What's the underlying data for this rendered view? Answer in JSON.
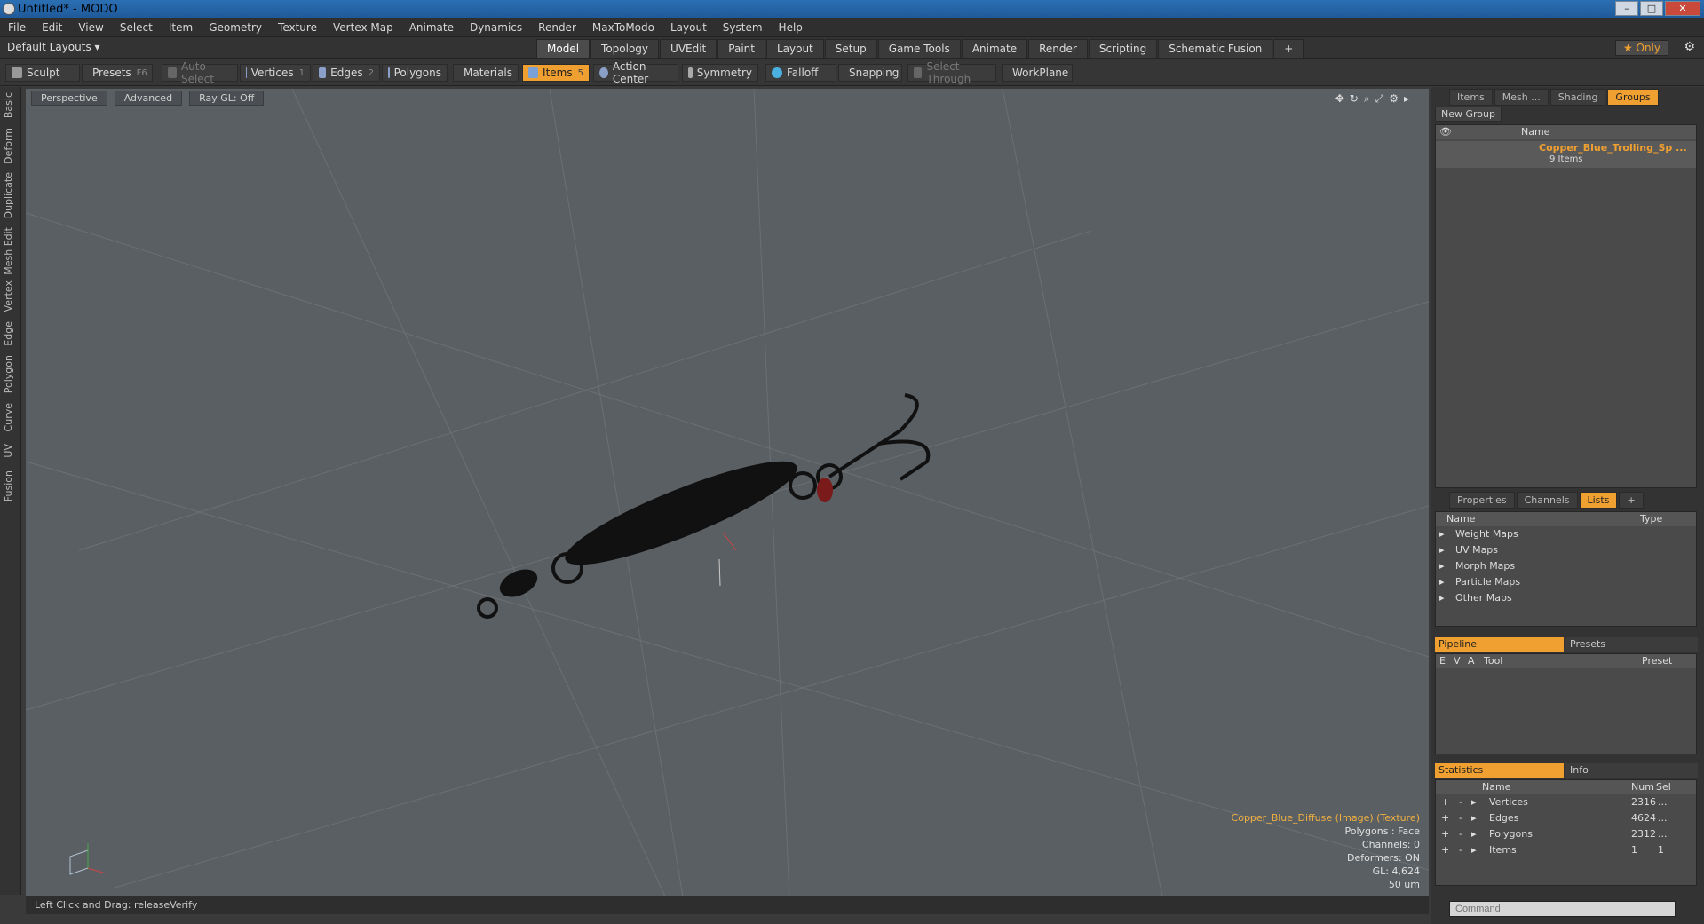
{
  "app": {
    "title": "Untitled* - MODO"
  },
  "menu": [
    "File",
    "Edit",
    "View",
    "Select",
    "Item",
    "Geometry",
    "Texture",
    "Vertex Map",
    "Animate",
    "Dynamics",
    "Render",
    "MaxToModo",
    "Layout",
    "System",
    "Help"
  ],
  "layout": {
    "selector": "Default Layouts ▾",
    "tabs": [
      "Model",
      "Topology",
      "UVEdit",
      "Paint",
      "Layout",
      "Setup",
      "Game Tools",
      "Animate",
      "Render",
      "Scripting",
      "Schematic Fusion",
      "+"
    ],
    "only_label": "★ Only"
  },
  "toolbar": {
    "sculpt": "Sculpt",
    "presets": "Presets",
    "presets_key": "F6",
    "auto_select": "Auto Select",
    "vertices": "Vertices",
    "vertices_key": "1",
    "edges": "Edges",
    "edges_key": "2",
    "polygons": "Polygons",
    "materials": "Materials",
    "items": "Items",
    "items_key": "5",
    "action_center": "Action Center",
    "symmetry": "Symmetry",
    "falloff": "Falloff",
    "snapping": "Snapping",
    "select_through": "Select Through",
    "workplane": "WorkPlane"
  },
  "left_tabs": [
    "Basic",
    "Deform",
    "Duplicate",
    "Mesh Edit",
    "Vertex",
    "Edge",
    "Polygon",
    "Curve",
    "UV",
    "Fusion"
  ],
  "viewport": {
    "perspective": "Perspective",
    "advanced": "Advanced",
    "raygl": "Ray GL: Off",
    "hud": {
      "texture": "Copper_Blue_Diffuse (Image) (Texture)",
      "polygons": "Polygons : Face",
      "channels": "Channels: 0",
      "deformers": "Deformers: ON",
      "gl": "GL: 4,624",
      "scale": "50 um"
    }
  },
  "status": {
    "text": "Left Click and Drag:   releaseVerify"
  },
  "groups_panel": {
    "tabs": [
      "Items",
      "Mesh ...",
      "Shading",
      "Groups"
    ],
    "new_group": "New Group",
    "name_header": "Name",
    "group_name": "Copper_Blue_Trolling_Sp ...",
    "group_count": "9 Items"
  },
  "lists_panel": {
    "tabs": [
      "Properties",
      "Channels",
      "Lists",
      "+"
    ],
    "name_header": "Name",
    "type_header": "Type",
    "items": [
      "Weight Maps",
      "UV Maps",
      "Morph Maps",
      "Particle Maps",
      "Other Maps"
    ]
  },
  "pipeline_panel": {
    "pipeline": "Pipeline",
    "presets": "Presets",
    "headers": [
      "E",
      "V",
      "A",
      "Tool",
      "Preset"
    ]
  },
  "stats_panel": {
    "statistics": "Statistics",
    "info": "Info",
    "headers": {
      "name": "Name",
      "num": "Num",
      "sel": "Sel"
    },
    "rows": [
      {
        "name": "Vertices",
        "num": "2316",
        "sel": "..."
      },
      {
        "name": "Edges",
        "num": "4624",
        "sel": "..."
      },
      {
        "name": "Polygons",
        "num": "2312",
        "sel": "..."
      },
      {
        "name": "Items",
        "num": "1",
        "sel": "1"
      }
    ]
  },
  "command": {
    "placeholder": "Command"
  },
  "colors": {
    "accent": "#f0a030",
    "viewport": "#5a5f63"
  }
}
